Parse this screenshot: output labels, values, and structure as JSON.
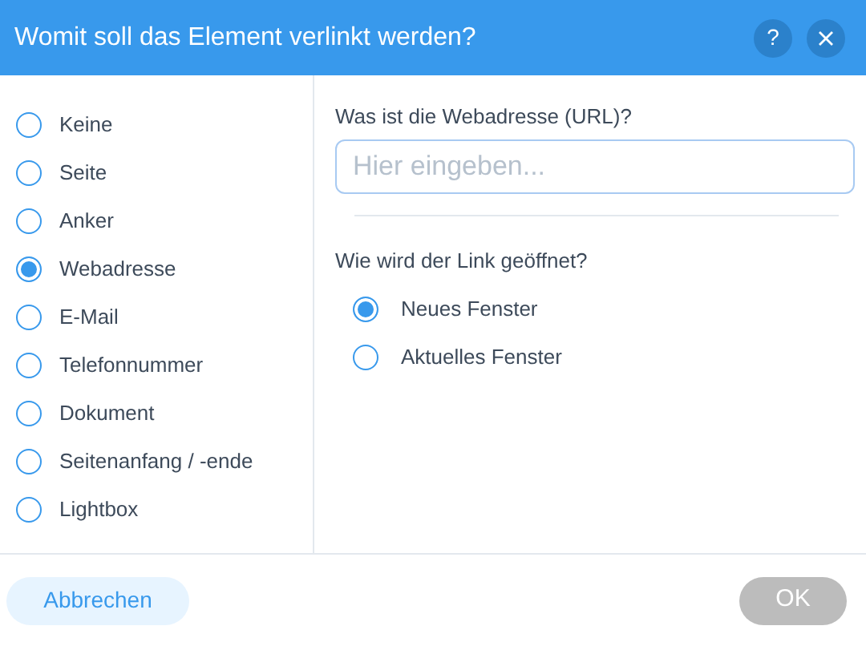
{
  "window": {
    "title": "Womit soll das Element verlinkt werden?"
  },
  "header_buttons": [
    {
      "kind": "help",
      "label": "?"
    },
    {
      "kind": "close"
    }
  ],
  "link_types": [
    {
      "label": "Keine",
      "selected": false
    },
    {
      "label": "Seite",
      "selected": false
    },
    {
      "label": "Anker",
      "selected": false
    },
    {
      "label": "Webadresse",
      "selected": true
    },
    {
      "label": "E-Mail",
      "selected": false
    },
    {
      "label": "Telefonnummer",
      "selected": false
    },
    {
      "label": "Dokument",
      "selected": false
    },
    {
      "label": "Seitenanfang / -ende",
      "selected": false
    },
    {
      "label": "Lightbox",
      "selected": false
    }
  ],
  "url_field": {
    "label": "Was ist die Webadresse (URL)?",
    "placeholder": "Hier eingeben..."
  },
  "open_mode": {
    "label": "Wie wird der Link geöffnet?",
    "options": [
      {
        "label": "Neues Fenster",
        "selected": true
      },
      {
        "label": "Aktuelles Fenster",
        "selected": false
      }
    ]
  },
  "footer": {
    "cancel": {
      "label": "Abbrechen"
    },
    "ok": {
      "label": "OK",
      "disabled": true
    }
  }
}
